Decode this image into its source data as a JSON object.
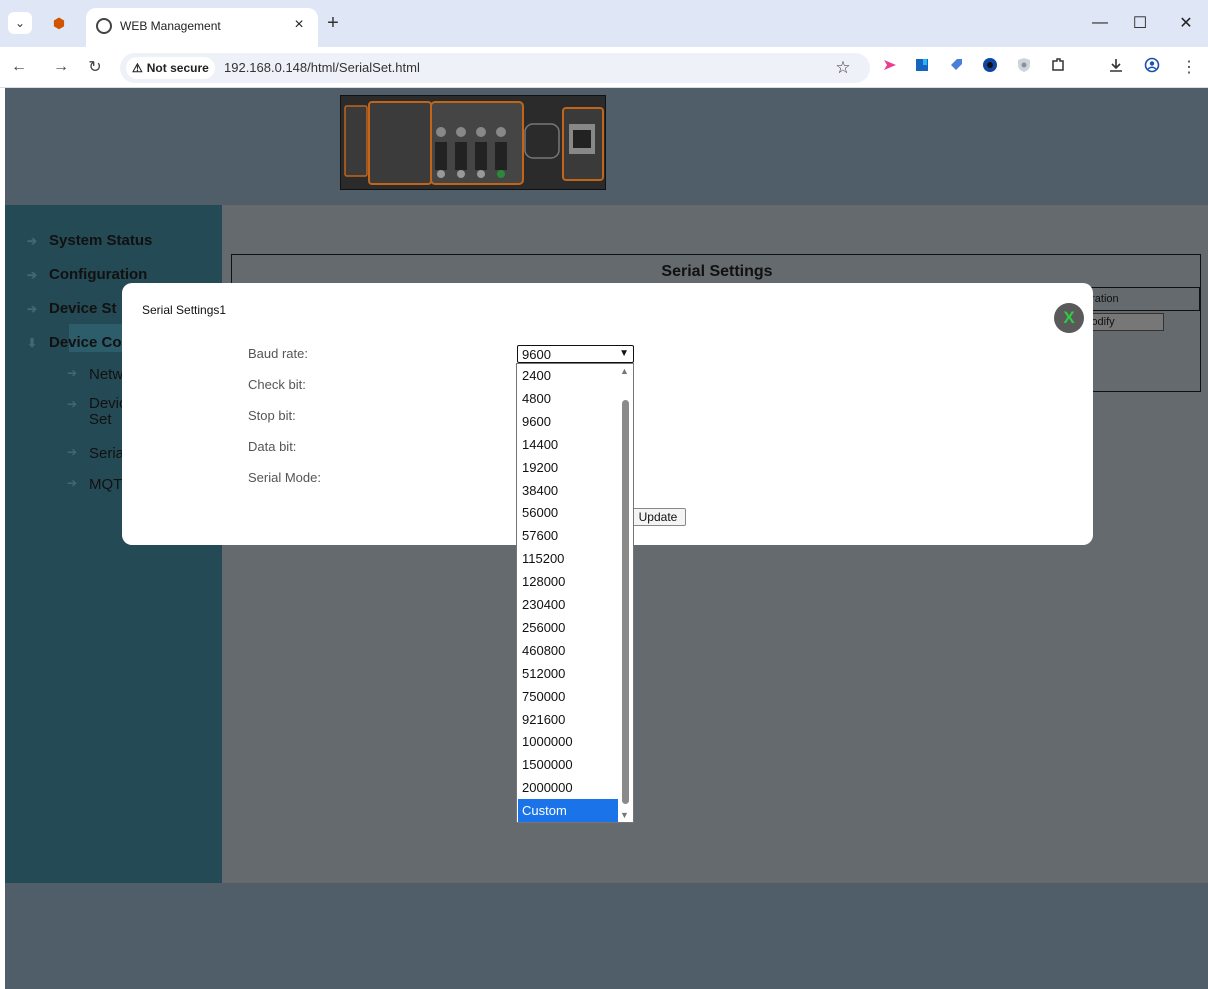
{
  "browser": {
    "tab_title": "WEB Management",
    "tab_close": "×",
    "new_tab": "+",
    "not_secure": "Not secure",
    "url": "192.168.0.148/html/SerialSet.html",
    "window_controls": [
      "—",
      "☐",
      "✕"
    ]
  },
  "sidebar": {
    "items": [
      {
        "label": "System Status"
      },
      {
        "label": "Configuration"
      },
      {
        "label": "Device St"
      },
      {
        "label": "Device Co"
      }
    ],
    "subitems": [
      {
        "label": "Netw"
      },
      {
        "label": "Devic\nSet"
      },
      {
        "label": "Seria"
      },
      {
        "label": "MQT"
      }
    ]
  },
  "panel": {
    "title": "Serial Settings",
    "op_header": "eration",
    "modify": "lodify"
  },
  "modal": {
    "title": "Serial Settings1",
    "close": "X",
    "labels": [
      "Baud rate:",
      "Check bit:",
      "Stop bit:",
      "Data bit:",
      "Serial Mode:"
    ],
    "update": "Update",
    "baud_value": "9600",
    "baud_options": [
      "2400",
      "4800",
      "9600",
      "14400",
      "19200",
      "38400",
      "56000",
      "57600",
      "115200",
      "128000",
      "230400",
      "256000",
      "460800",
      "512000",
      "750000",
      "921600",
      "1000000",
      "1500000",
      "2000000",
      "Custom"
    ],
    "selected_option": "Custom"
  },
  "colors": {
    "sidebar": "#244a55",
    "main": "#646a6e",
    "accent": "#1a73e8",
    "close_x": "#2ecc40"
  }
}
